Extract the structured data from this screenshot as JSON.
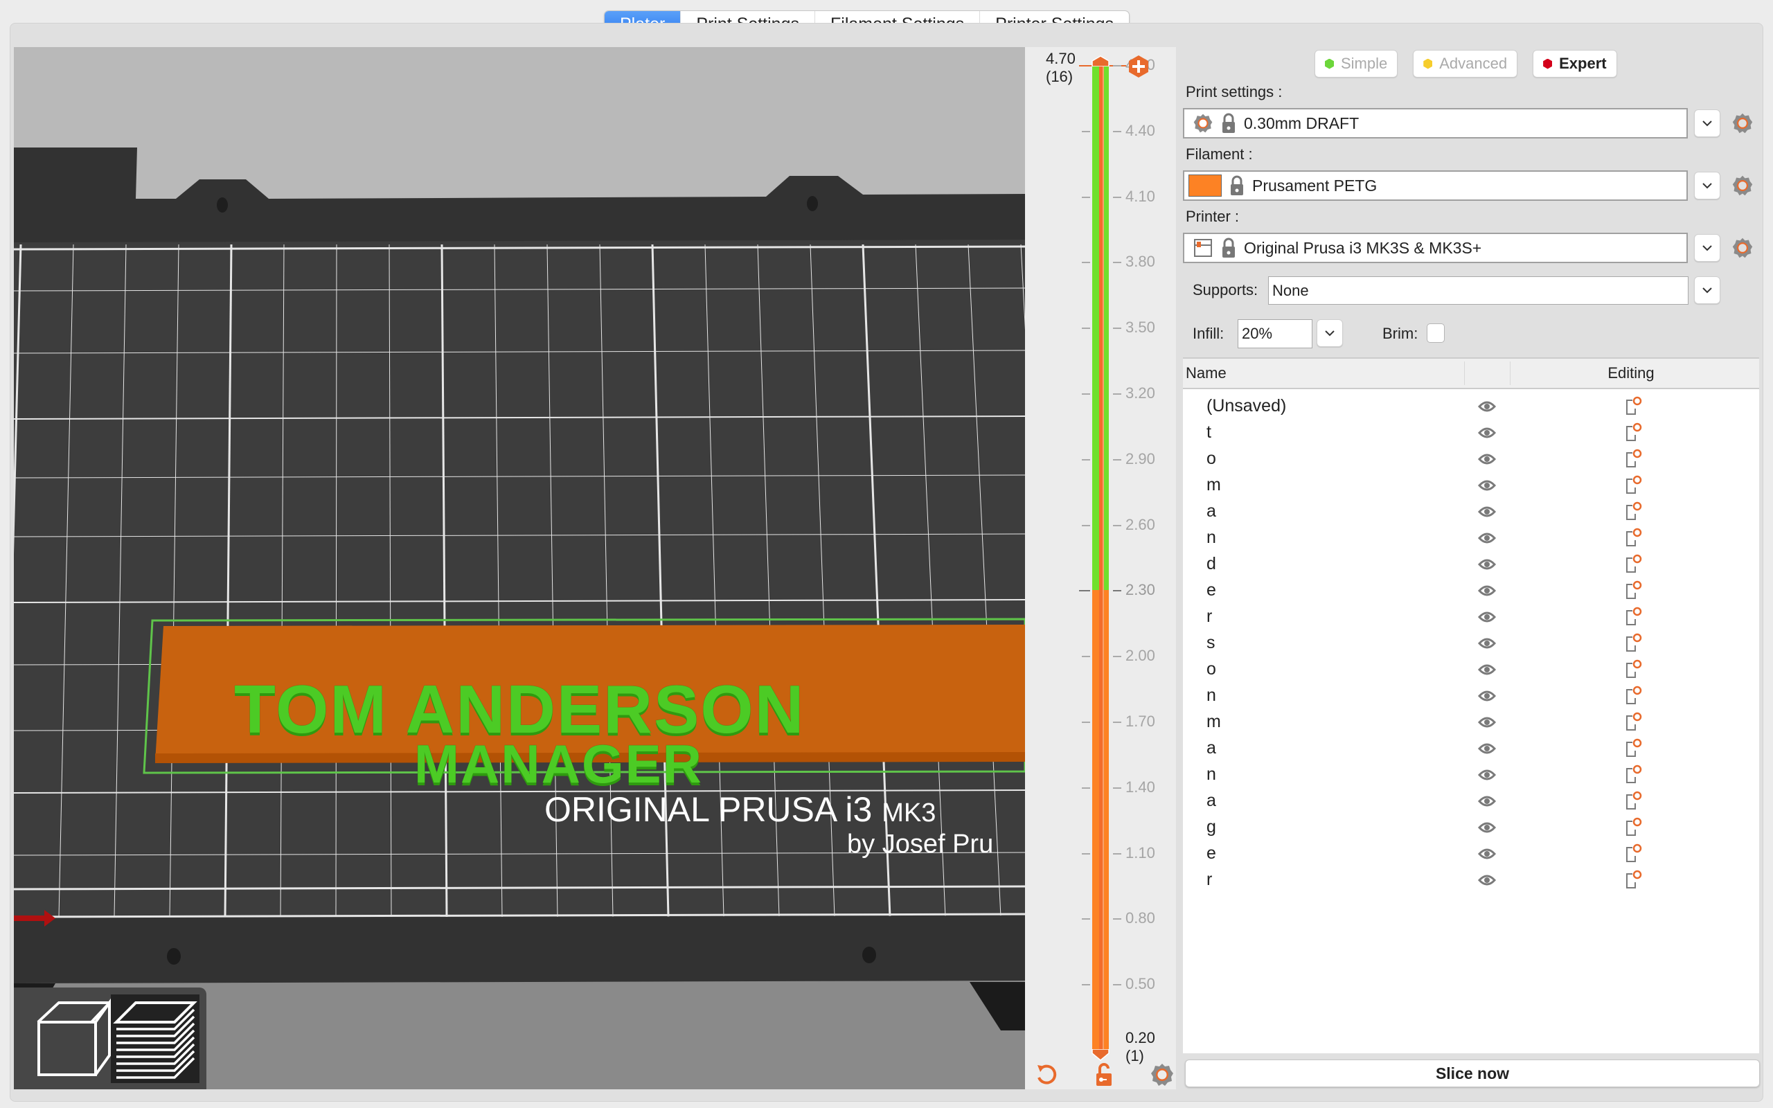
{
  "tabs": [
    {
      "label": "Plater",
      "active": true
    },
    {
      "label": "Print Settings",
      "active": false
    },
    {
      "label": "Filament Settings",
      "active": false
    },
    {
      "label": "Printer Settings",
      "active": false
    }
  ],
  "viewport": {
    "plate_line1": "TOM ANDERSON",
    "plate_line2": "MANAGER",
    "bed_title": "ORIGINAL PRUSA i3",
    "bed_model": "MK3",
    "bed_subtitle": "by Josef Pru",
    "toolbar": {
      "view3d_icon": "cube-icon",
      "preview_icon": "layers-icon"
    }
  },
  "layer_slider": {
    "top_value": "4.70",
    "top_layer": "(16)",
    "bottom_value": "0.20",
    "bottom_layer": "(1)",
    "color_change_at": "2.30",
    "ticks": [
      "4.70",
      "4.40",
      "4.10",
      "3.80",
      "3.50",
      "3.20",
      "2.90",
      "2.60",
      "2.30",
      "2.00",
      "1.70",
      "1.40",
      "1.10",
      "0.80",
      "0.50"
    ],
    "colors": {
      "upper": "#6fe02c",
      "lower": "#fd8224",
      "accent": "#e86a2c"
    },
    "icons": {
      "add": "add-color-change-icon",
      "revert": "revert-icon",
      "lock": "unlock-icon",
      "settings": "cog-icon"
    }
  },
  "modes": [
    {
      "label": "Simple",
      "color": "#6cd63a",
      "active": false
    },
    {
      "label": "Advanced",
      "color": "#f6cd2c",
      "active": false
    },
    {
      "label": "Expert",
      "color": "#d3001a",
      "active": true
    }
  ],
  "print_settings": {
    "label": "Print settings :",
    "value": "0.30mm DRAFT"
  },
  "filament": {
    "label": "Filament :",
    "value": "Prusament PETG",
    "color": "#fd8224"
  },
  "printer": {
    "label": "Printer :",
    "value": "Original Prusa i3 MK3S & MK3S+"
  },
  "supports": {
    "label": "Supports:",
    "value": "None"
  },
  "infill": {
    "label": "Infill:",
    "value": "20%"
  },
  "brim": {
    "label": "Brim:",
    "checked": false
  },
  "object_list": {
    "columns": {
      "name": "Name",
      "editing": "Editing"
    },
    "rows": [
      "(Unsaved)",
      "t",
      "o",
      "m",
      "a",
      "n",
      "d",
      "e",
      "r",
      "s",
      "o",
      "n",
      "m",
      "a",
      "n",
      "a",
      "g",
      "e",
      "r"
    ]
  },
  "slice_button": "Slice now"
}
